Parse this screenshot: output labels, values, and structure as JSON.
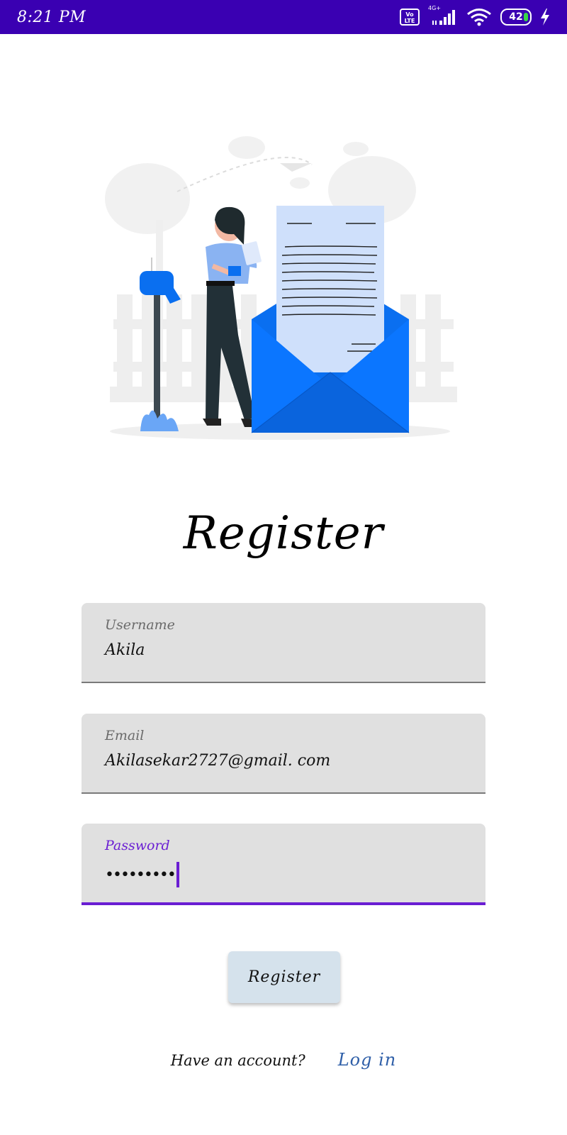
{
  "status_bar": {
    "time": "8:21 PM",
    "volte_label_top": "Vo",
    "volte_label_bottom": "LTE",
    "network_type": "4G+",
    "battery_level": "42",
    "icons": [
      "volte-icon",
      "signal-icon",
      "wifi-icon",
      "battery-icon",
      "charging-icon"
    ]
  },
  "illustration": {
    "icon": "mail-registration-illustration"
  },
  "title": "Register",
  "form": {
    "username": {
      "label": "Username",
      "value": "Akila"
    },
    "email": {
      "label": "Email",
      "value": "Akilasekar2727@gmail. com"
    },
    "password": {
      "label": "Password",
      "value": "•••••••••"
    }
  },
  "register_button": "Register",
  "footer": {
    "prompt": "Have an account?",
    "login_link": "Log in"
  },
  "colors": {
    "status_bar": "#3a00b2",
    "accent": "#6a1ed3",
    "field_bg": "#e0e0e0",
    "button_bg": "#d5e2ec",
    "link": "#2f5fa8",
    "illustration_blue": "#0a6ff0"
  }
}
